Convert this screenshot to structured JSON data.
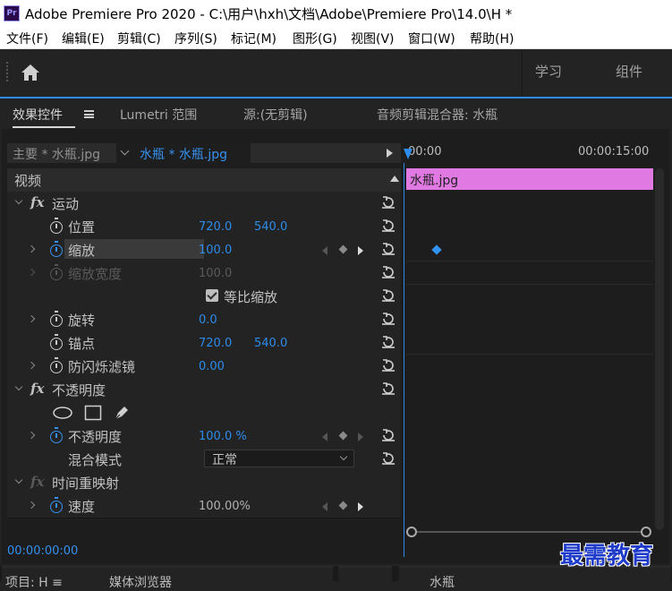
{
  "window": {
    "title": "Adobe Premiere Pro 2020 - C:\\用户\\hxh\\文档\\Adobe\\Premiere Pro\\14.0\\H *",
    "logo_text": "Pr"
  },
  "menu": [
    "文件(F)",
    "编辑(E)",
    "剪辑(C)",
    "序列(S)",
    "标记(M)",
    "图形(G)",
    "视图(V)",
    "窗口(W)",
    "帮助(H)"
  ],
  "workspace": {
    "tabs": [
      "学习",
      "组件"
    ]
  },
  "panel_tabs": {
    "effect_controls": "效果控件",
    "lumetri": "Lumetri 范围",
    "source": "源:(无剪辑)",
    "audio_mixer": "音频剪辑混合器: 水瓶"
  },
  "source_bar": {
    "master": "主要 * 水瓶.jpg",
    "clip": "水瓶 * 水瓶.jpg"
  },
  "timeline": {
    "tc_start": "00:00",
    "tc_end": "00:00:15:00",
    "clip_name": "水瓶.jpg"
  },
  "sections": {
    "video": "视频",
    "motion": "运动",
    "opacity": "不透明度",
    "time_remap": "时间重映射",
    "fx": "fx"
  },
  "properties": {
    "position": {
      "label": "位置",
      "x": "720.0",
      "y": "540.0"
    },
    "scale": {
      "label": "缩放",
      "value": "100.0"
    },
    "scale_width": {
      "label": "缩放宽度",
      "value": "100.0"
    },
    "uniform_scale": {
      "label": "等比缩放"
    },
    "rotation": {
      "label": "旋转",
      "value": "0.0"
    },
    "anchor": {
      "label": "锚点",
      "x": "720.0",
      "y": "540.0"
    },
    "anti_flicker": {
      "label": "防闪烁滤镜",
      "value": "0.00"
    },
    "opacity": {
      "label": "不透明度",
      "value": "100.0 %"
    },
    "blend_mode": {
      "label": "混合模式",
      "value": "正常"
    },
    "speed": {
      "label": "速度",
      "value": "100.00%"
    }
  },
  "status": {
    "timecode": "00:00:00:00"
  },
  "bottom_panels": {
    "project": "项目: H ≡",
    "media_browser": "媒体浏览器",
    "sequence": "水瓶"
  },
  "watermark": "最需教育",
  "colors": {
    "accent": "#2d8ceb",
    "clip": "#e179e3",
    "watermark": "#1e3cc9"
  }
}
